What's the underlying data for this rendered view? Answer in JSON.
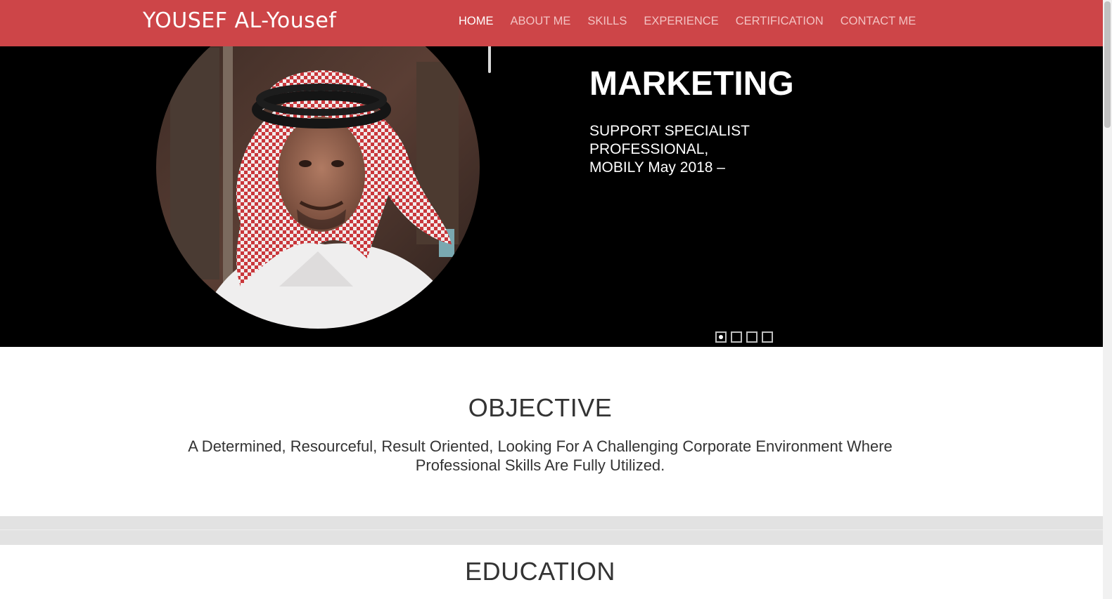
{
  "header": {
    "brand": "YOUSEF AL-Yousef",
    "brand_color": "#cd4548",
    "nav": [
      {
        "label": "HOME",
        "active": true
      },
      {
        "label": "ABOUT ME",
        "active": false
      },
      {
        "label": "SKILLS",
        "active": false
      },
      {
        "label": "EXPERIENCE",
        "active": false
      },
      {
        "label": "CERTIFICATION",
        "active": false
      },
      {
        "label": "CONTACT ME",
        "active": false
      }
    ]
  },
  "hero": {
    "title": "MARKETING",
    "subtitle_lines": [
      "SUPPORT SPECIALIST",
      "PROFESSIONAL,",
      "MOBILY May 2018 –"
    ],
    "portrait_icon": "profile-photo",
    "slides_total": 4,
    "active_slide": 1
  },
  "objective": {
    "title": "OBJECTIVE",
    "text": "A Determined, Resourceful, Result Oriented, Looking For A Challenging Corporate Environment Where Professional Skills Are Fully Utilized."
  },
  "education": {
    "title": "EDUCATION"
  }
}
